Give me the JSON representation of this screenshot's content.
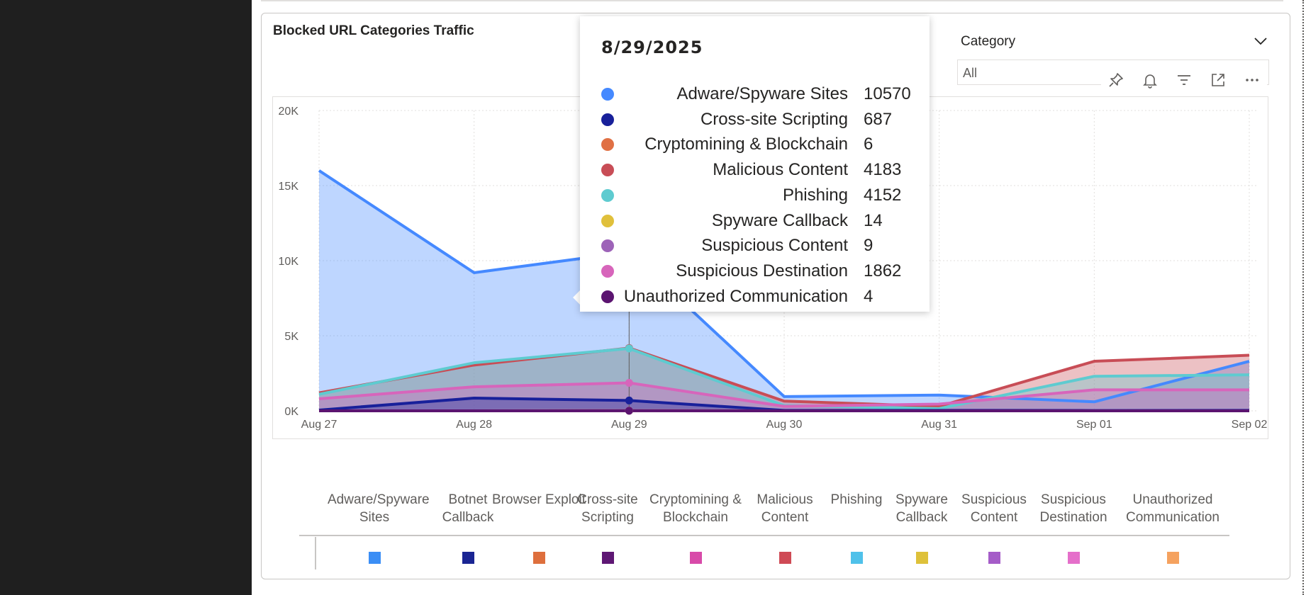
{
  "visual": {
    "title": "Blocked URL Categories Traffic"
  },
  "slicer": {
    "title": "Category",
    "value": "All"
  },
  "toolbar": {
    "icons": [
      "pin-icon",
      "bell-icon",
      "filter-icon",
      "focus-mode-icon",
      "more-options-icon"
    ]
  },
  "chart_data": {
    "type": "area",
    "x": [
      "Aug 27",
      "Aug 28",
      "Aug 29",
      "Aug 30",
      "Aug 31",
      "Sep 01",
      "Sep 02"
    ],
    "y_ticks": [
      "0K",
      "5K",
      "10K",
      "15K",
      "20K"
    ],
    "ylim": [
      0,
      20000
    ],
    "grid": true,
    "legend_position": "bottom",
    "series": [
      {
        "name": "Adware/Spyware Sites",
        "color": "#4589ff",
        "values": [
          16000,
          9200,
          10570,
          950,
          1050,
          600,
          3300
        ]
      },
      {
        "name": "Malicious Content",
        "color": "#c84d56",
        "values": [
          1200,
          3050,
          4183,
          650,
          300,
          3300,
          3700
        ]
      },
      {
        "name": "Phishing",
        "color": "#5ecbd0",
        "values": [
          1100,
          3200,
          4152,
          350,
          150,
          2300,
          2400
        ]
      },
      {
        "name": "Suspicious Destination",
        "color": "#d765bb",
        "values": [
          800,
          1600,
          1862,
          300,
          450,
          1400,
          1400
        ]
      },
      {
        "name": "Cross-site Scripting",
        "color": "#18209a",
        "values": [
          50,
          850,
          687,
          30,
          30,
          20,
          30
        ]
      },
      {
        "name": "Cryptomining & Blockchain",
        "color": "#e07044",
        "values": [
          0,
          0,
          6,
          0,
          0,
          0,
          0
        ]
      },
      {
        "name": "Spyware Callback",
        "color": "#e0c03b",
        "values": [
          0,
          0,
          14,
          0,
          0,
          0,
          0
        ]
      },
      {
        "name": "Suspicious Content",
        "color": "#9d63b8",
        "values": [
          0,
          0,
          9,
          0,
          0,
          0,
          0
        ]
      },
      {
        "name": "Unauthorized Communication",
        "color": "#5b1470",
        "values": [
          0,
          0,
          4,
          0,
          0,
          0,
          0
        ]
      }
    ]
  },
  "legend": {
    "items": [
      {
        "label": "Adware/Spyware Sites",
        "color": "#3b8ef5"
      },
      {
        "label": "Botnet Callback",
        "color": "#1a2593"
      },
      {
        "label": "Browser Exploit",
        "color": "#de6f3d"
      },
      {
        "label": "Cross-site Scripting",
        "color": "#5e1774"
      },
      {
        "label": "Cryptomining & Blockchain",
        "color": "#d84aa9"
      },
      {
        "label": "Malicious Content",
        "color": "#cf4a55"
      },
      {
        "label": "Phishing",
        "color": "#4fc1ea"
      },
      {
        "label": "Spyware Callback",
        "color": "#dec13a"
      },
      {
        "label": "Suspicious Content",
        "color": "#a55cc8"
      },
      {
        "label": "Suspicious Destination",
        "color": "#e56fca"
      },
      {
        "label": "Unauthorized Communication",
        "color": "#f5a25f"
      }
    ]
  },
  "tooltip": {
    "date": "8/29/2025",
    "rows": [
      {
        "label": "Adware/Spyware Sites",
        "value": "10570",
        "color": "#4589ff"
      },
      {
        "label": "Cross-site Scripting",
        "value": "687",
        "color": "#18209a"
      },
      {
        "label": "Cryptomining & Blockchain",
        "value": "6",
        "color": "#e07044"
      },
      {
        "label": "Malicious Content",
        "value": "4183",
        "color": "#c84d56"
      },
      {
        "label": "Phishing",
        "value": "4152",
        "color": "#5ecbd0"
      },
      {
        "label": "Spyware Callback",
        "value": "14",
        "color": "#e0c03b"
      },
      {
        "label": "Suspicious Content",
        "value": "9",
        "color": "#9d63b8"
      },
      {
        "label": "Suspicious Destination",
        "value": "1862",
        "color": "#d765bb"
      },
      {
        "label": "Unauthorized Communication",
        "value": "4",
        "color": "#5b1470"
      }
    ]
  }
}
